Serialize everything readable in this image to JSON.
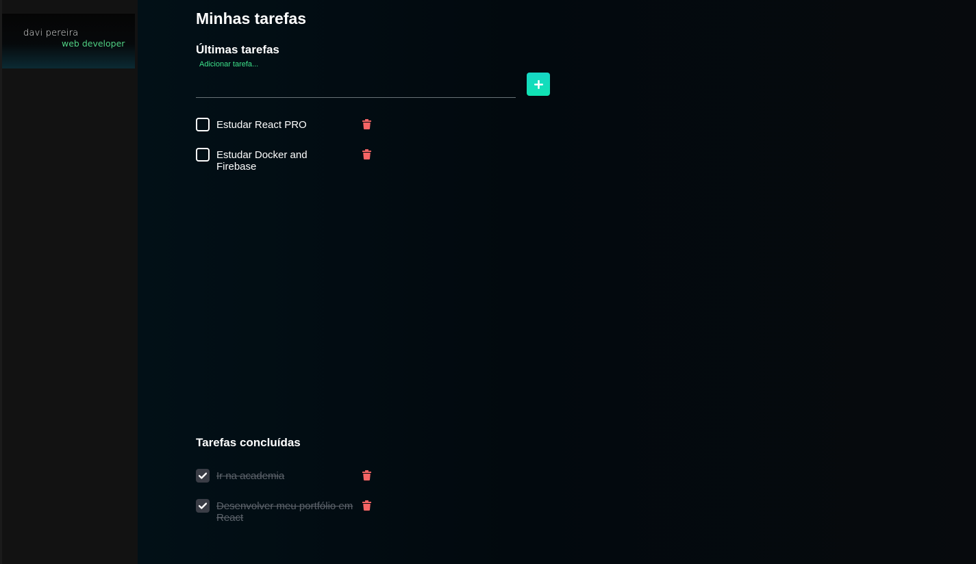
{
  "sidebar": {
    "logo_name": "davi pereira",
    "logo_role": "web developer"
  },
  "main": {
    "title": "Minhas tarefas",
    "latest_section_title": "Últimas tarefas",
    "input": {
      "label": "Adicionar tarefa...",
      "value": "",
      "add_button_icon": "plus-icon"
    },
    "pending_tasks": [
      {
        "text": "Estudar React PRO",
        "checked": false
      },
      {
        "text": "Estudar Docker and Firebase",
        "checked": false
      }
    ],
    "completed_section_title": "Tarefas concluídas",
    "completed_tasks": [
      {
        "text": "Ir na academia",
        "checked": true
      },
      {
        "text": "Desenvolver meu portfólio em React",
        "checked": true
      }
    ]
  },
  "colors": {
    "accent_green": "#3de28a",
    "add_button": "#10e3b2",
    "trash": "#f56565",
    "done_text": "#5d636b"
  },
  "icons": {
    "trash": "trash-icon",
    "check": "check-icon"
  }
}
